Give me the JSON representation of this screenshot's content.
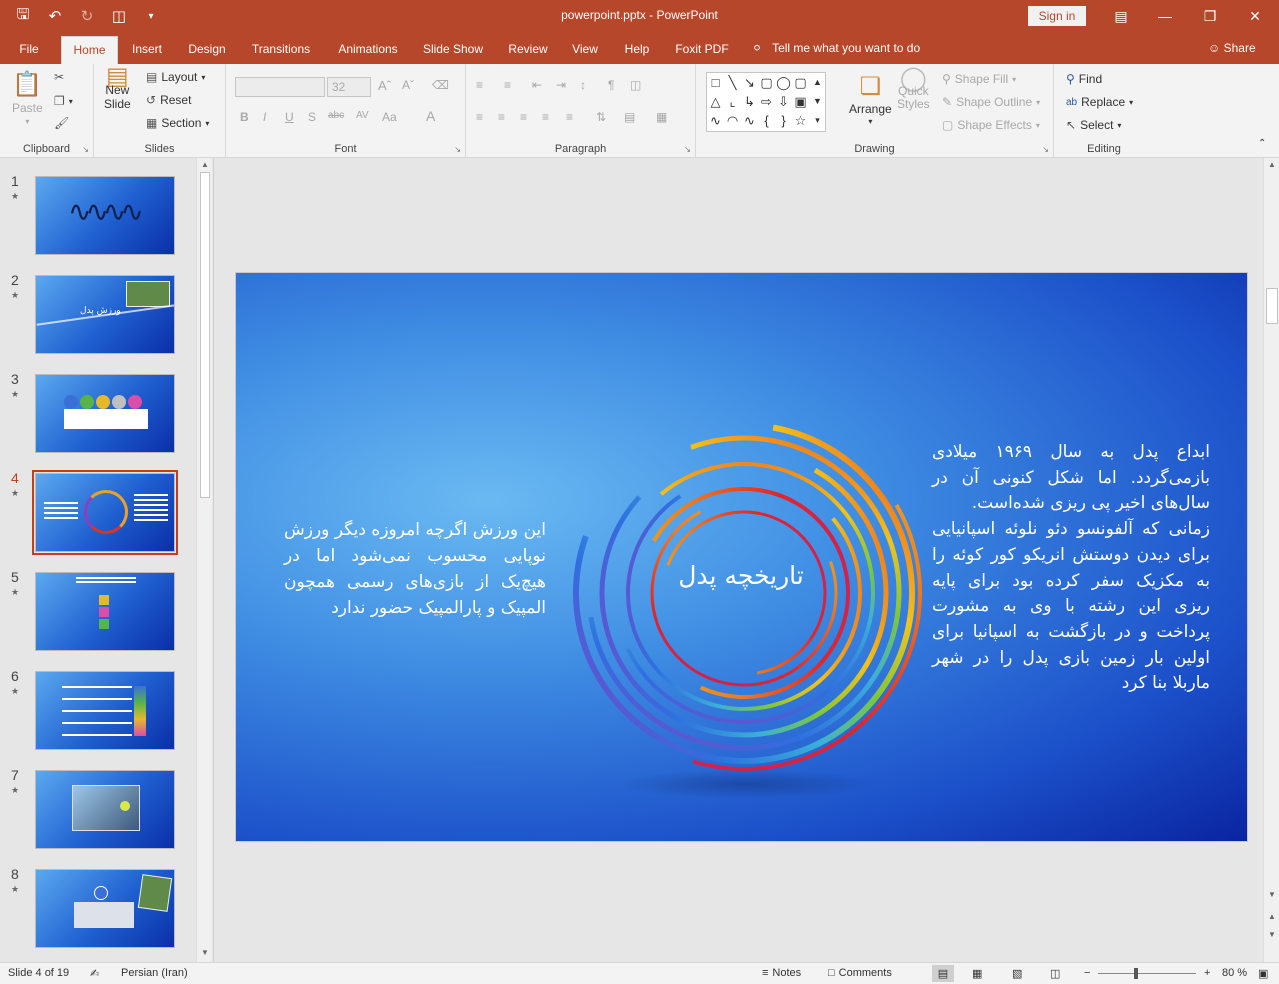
{
  "app": {
    "window_title": "powerpoint.pptx - PowerPoint",
    "sign_in": "Sign in",
    "tell_me": "Tell me what you want to do",
    "share": "Share"
  },
  "tabs": [
    "File",
    "Home",
    "Insert",
    "Design",
    "Transitions",
    "Animations",
    "Slide Show",
    "Review",
    "View",
    "Help",
    "Foxit PDF"
  ],
  "active_tab": "Home",
  "ribbon": {
    "clipboard": {
      "label": "Clipboard",
      "paste": "Paste"
    },
    "slides": {
      "label": "Slides",
      "new_slide_1": "New",
      "new_slide_2": "Slide",
      "layout": "Layout",
      "reset": "Reset",
      "section": "Section"
    },
    "font": {
      "label": "Font",
      "size": "32"
    },
    "paragraph": {
      "label": "Paragraph"
    },
    "drawing": {
      "label": "Drawing",
      "arrange": "Arrange",
      "quick_styles_1": "Quick",
      "quick_styles_2": "Styles",
      "shape_fill": "Shape Fill",
      "shape_outline": "Shape Outline",
      "shape_effects": "Shape Effects"
    },
    "editing": {
      "label": "Editing",
      "find": "Find",
      "replace": "Replace",
      "select": "Select"
    }
  },
  "thumbnails": [
    {
      "num": "1",
      "caption": ""
    },
    {
      "num": "2",
      "caption": "ورزش پدل"
    },
    {
      "num": "3",
      "caption": ""
    },
    {
      "num": "4",
      "caption": ""
    },
    {
      "num": "5",
      "caption": ""
    },
    {
      "num": "6",
      "caption": ""
    },
    {
      "num": "7",
      "caption": ""
    },
    {
      "num": "8",
      "caption": ""
    }
  ],
  "active_slide": 4,
  "slide": {
    "title": "تاریخچه پدل",
    "left_text": "این ورزش اگرچه امروزه دیگر ورزش نوپایی محسوب نمی‌شود اما در هیچ‌یک از بازی‌های رسمی همچون المپیک و پارالمپیک حضور ندارد",
    "right_text_1": "ابداع پدل به سال ۱۹۶۹ میلادی بازمی‌گردد. اما شکل کنونی آن در سال‌های اخیر پی ریزی شده‌است.",
    "right_text_2": "زمانی که آلفونسو دئو نلوئه اسپانیایی برای دیدن دوستش انریکو کور کوئه را به مکزیک سفر کرده بود برای پایه ریزی این رشته با وی به مشورت پرداخت و در بازگشت به اسپانیا برای اولین بار زمین بازی پدل را در شهر ماربلا بنا کرد"
  },
  "status": {
    "slide_info": "Slide 4 of 19",
    "language": "Persian (Iran)",
    "notes": "Notes",
    "comments": "Comments",
    "zoom": "80 %"
  },
  "colors": {
    "accent": "#b7472a",
    "selection": "#c43e1c"
  }
}
